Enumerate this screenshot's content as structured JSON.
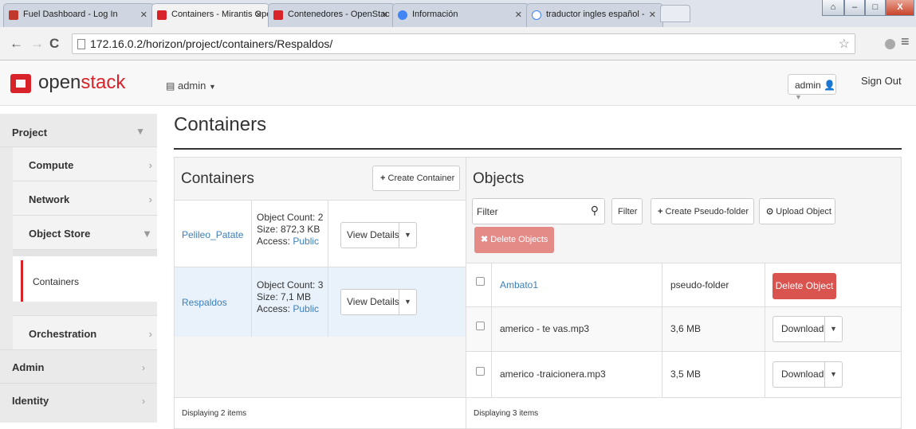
{
  "browser": {
    "tabs": [
      {
        "title": "Fuel Dashboard - Log In"
      },
      {
        "title": "Containers - Mirantis Ope"
      },
      {
        "title": "Contenedores - OpenStac"
      },
      {
        "title": "Información"
      },
      {
        "title": "traductor ingles español -"
      }
    ],
    "url": "172.16.0.2/horizon/project/containers/Respaldos/",
    "window_controls": {
      "minimize": "–",
      "maximize": "□",
      "close": "X"
    }
  },
  "header": {
    "logo_open": "open",
    "logo_stack": "stack",
    "project_selector": "admin",
    "user_menu": "admin",
    "sign_out": "Sign Out"
  },
  "sidebar": {
    "project": "Project",
    "compute": "Compute",
    "network": "Network",
    "object_store": "Object Store",
    "containers": "Containers",
    "orchestration": "Orchestration",
    "admin": "Admin",
    "identity": "Identity"
  },
  "page_title": "Containers",
  "containers_panel": {
    "heading": "Containers",
    "create_button": "Create Container",
    "rows": [
      {
        "name": "Pelileo_Patate",
        "count": "Object Count: 2",
        "size": "Size: 872,3 KB",
        "access_label": "Access:",
        "access": "Public",
        "action": "View Details"
      },
      {
        "name": "Respaldos",
        "count": "Object Count: 3",
        "size": "Size: 7,1 MB",
        "access_label": "Access:",
        "access": "Public",
        "action": "View Details"
      }
    ],
    "footer": "Displaying 2 items"
  },
  "objects_panel": {
    "heading": "Objects",
    "filter_placeholder": "Filter",
    "filter_button": "Filter",
    "create_folder_button": "Create Pseudo-folder",
    "upload_button": "Upload Object",
    "delete_objects_button": "Delete Objects",
    "rows": [
      {
        "name": "Ambato1",
        "size": "pseudo-folder",
        "action": "Delete Object"
      },
      {
        "name": "americo - te vas.mp3",
        "size": "3,6 MB",
        "action": "Download"
      },
      {
        "name": "americo -traicionera.mp3",
        "size": "3,5 MB",
        "action": "Download"
      }
    ],
    "footer": "Displaying 3 items"
  },
  "colors": {
    "brand_red": "#d8232a",
    "link_blue": "#3c7fb8",
    "danger": "#d9534f"
  }
}
